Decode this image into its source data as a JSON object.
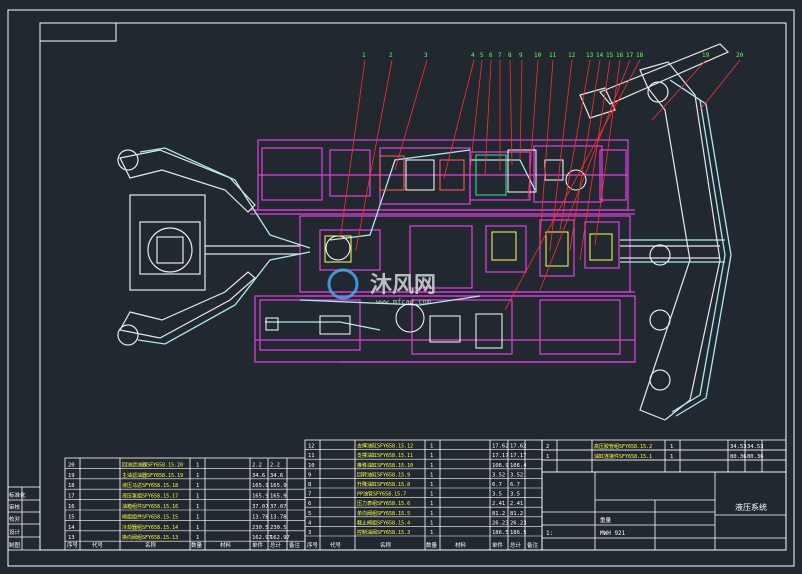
{
  "drawing": {
    "title": "液压系统",
    "drawing_no": "MWH 921",
    "scale": "1:",
    "left_block_labels": [
      "标准化",
      "审核",
      "校对",
      "设计",
      "制图"
    ],
    "bottom_header_left": [
      "序号",
      "代号",
      "名称",
      "数量",
      "材料"
    ],
    "bottom_header_right": [
      "单件",
      "总计",
      "备注"
    ],
    "mass_label": "重量"
  },
  "callouts": [
    "1",
    "2",
    "3",
    "4",
    "5",
    "6",
    "7",
    "8",
    "9",
    "10",
    "11",
    "12",
    "13",
    "14",
    "15",
    "16",
    "17",
    "18",
    "19",
    "20"
  ],
  "bom_left": {
    "rows": [
      {
        "no": "20",
        "name": "回油滤油器SFY658.15.20",
        "qty": "1",
        "w1": "2.2",
        "w2": "2.2"
      },
      {
        "no": "19",
        "name": "主油滤油器SFY658.15.19",
        "qty": "1",
        "w1": "34.6",
        "w2": "34.6"
      },
      {
        "no": "18",
        "name": "液压马达SFY658.15.18",
        "qty": "1",
        "w1": "165.9",
        "w2": "165.9"
      },
      {
        "no": "17",
        "name": "液压泵组SFY658.15.17",
        "qty": "1",
        "w1": "165.9",
        "w2": "165.9"
      },
      {
        "no": "16",
        "name": "油箱组件SFY658.15.16",
        "qty": "1",
        "w1": "37.07",
        "w2": "37.07"
      },
      {
        "no": "15",
        "name": "阀组组件SFY658.15.15",
        "qty": "1",
        "w1": "13.78",
        "w2": "13.78"
      },
      {
        "no": "14",
        "name": "冷却器组SFY658.15.14",
        "qty": "1",
        "w1": "230.5",
        "w2": "230.5"
      },
      {
        "no": "13",
        "name": "换向阀组SFY658.15.13",
        "qty": "1",
        "w1": "162.97",
        "w2": "162.97"
      }
    ]
  },
  "bom_mid": {
    "rows": [
      {
        "no": "12",
        "name": "支撑油缸SFY658.15.12",
        "qty": "1",
        "w1": "17.62",
        "w2": "17.62"
      },
      {
        "no": "11",
        "name": "支撑油缸SFY658.15.11",
        "qty": "1",
        "w1": "17.17",
        "w2": "17.17"
      },
      {
        "no": "10",
        "name": "推移油缸SFY658.15.10",
        "qty": "1",
        "w1": "106.9",
        "w2": "106.4"
      },
      {
        "no": "9",
        "name": "回转油缸SFY658.15.9",
        "qty": "1",
        "w1": "3.52",
        "w2": "3.52"
      },
      {
        "no": "8",
        "name": "升降油缸SFY658.15.8",
        "qty": "1",
        "w1": "6.7",
        "w2": "6.7"
      },
      {
        "no": "7",
        "name": "PP油管SFY658.15.7",
        "qty": "1",
        "w1": "3.5",
        "w2": "3.5"
      },
      {
        "no": "6",
        "name": "压力表组SFY658.15.6",
        "qty": "1",
        "w1": "2.41",
        "w2": "2.41"
      },
      {
        "no": "5",
        "name": "单向阀组SFY658.15.5",
        "qty": "1",
        "w1": "81.2",
        "w2": "81.2"
      },
      {
        "no": "4",
        "name": "截止阀组SFY658.15.4",
        "qty": "1",
        "w1": "26.23",
        "w2": "26.23"
      },
      {
        "no": "3",
        "name": "控制油阀SFY658.15.3",
        "qty": "1",
        "w1": "186.5",
        "w2": "186.5"
      }
    ]
  },
  "bom_right": {
    "rows": [
      {
        "no": "2",
        "name": "高压胶管组SFY658.15.2",
        "qty": "1",
        "w1": "34.53",
        "w2": "34.53"
      },
      {
        "no": "1",
        "name": "油缸连接件SFY658.15.1",
        "qty": "1",
        "w1": "80.36",
        "w2": "80.36"
      }
    ]
  },
  "watermark": {
    "text": "沐风网",
    "sub": "www.mfcad.com"
  }
}
